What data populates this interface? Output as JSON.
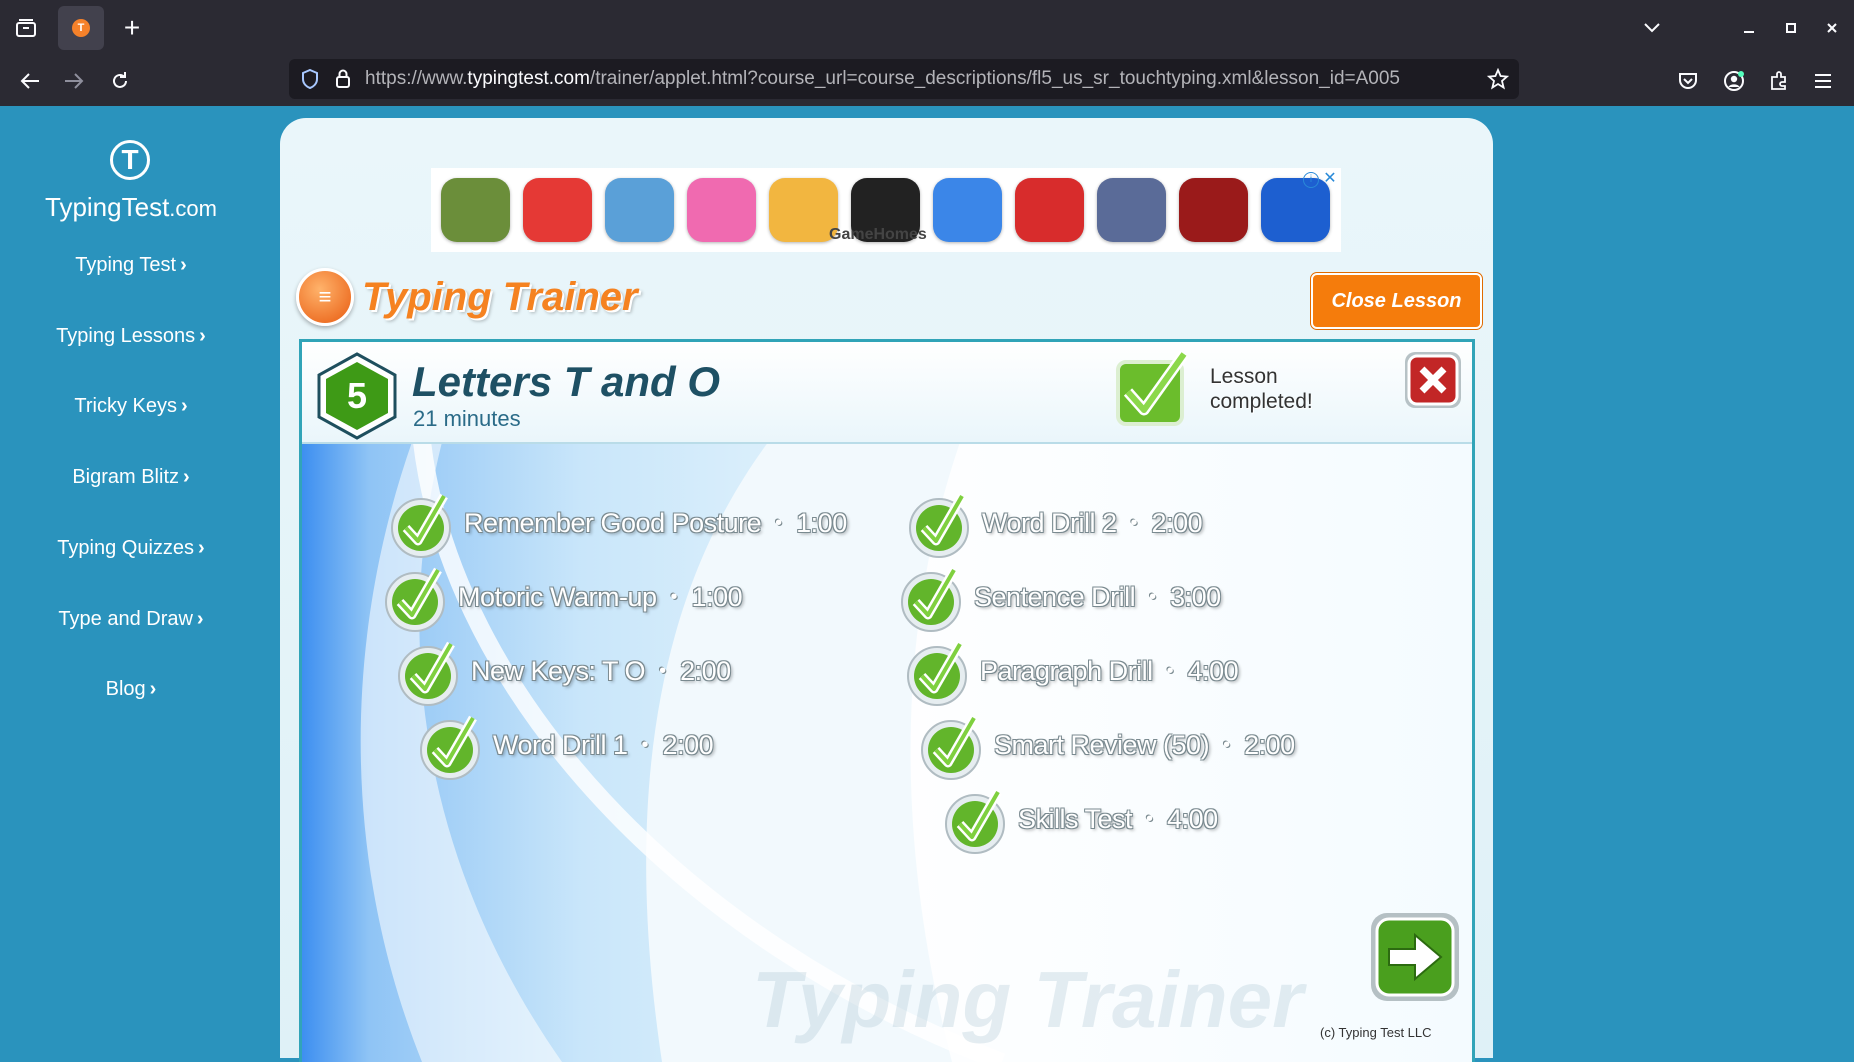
{
  "browser": {
    "url_prefix": "https://www.",
    "url_host": "typingtest.com",
    "url_path": "/trainer/applet.html?course_url=course_descriptions/fl5_us_sr_touchtyping.xml&lesson_id=A005",
    "new_tab_label": "+"
  },
  "sidebar": {
    "logo_name": "TypingTest",
    "logo_tld": ".com",
    "nav": [
      {
        "label": "Typing Test"
      },
      {
        "label": "Typing Lessons"
      },
      {
        "label": "Tricky Keys"
      },
      {
        "label": "Bigram Blitz"
      },
      {
        "label": "Typing Quizzes"
      },
      {
        "label": "Type and Draw"
      },
      {
        "label": "Blog"
      }
    ],
    "chevron": "›"
  },
  "ad": {
    "brand": "GameHomes",
    "tiles": [
      {
        "name": "minecraft",
        "color": "#6b8e3a"
      },
      {
        "name": "pokeball",
        "color": "#e53935"
      },
      {
        "name": "subway-surfers",
        "color": "#5aa0d8"
      },
      {
        "name": "talking-angela",
        "color": "#f06ab0"
      },
      {
        "name": "talking-tom-friends",
        "color": "#f2b640"
      },
      {
        "name": "roblox",
        "color": "#222222"
      },
      {
        "name": "snake",
        "color": "#3b86e8"
      },
      {
        "name": "among-us",
        "color": "#d82c2c"
      },
      {
        "name": "fortnite",
        "color": "#5a6b98"
      },
      {
        "name": "dragon",
        "color": "#9a1a1a"
      },
      {
        "name": "huggy-wuggy",
        "color": "#1d5fd0"
      }
    ]
  },
  "trainer": {
    "logo_text": "Typing Trainer",
    "close_lesson": "Close Lesson",
    "lesson_number": "5",
    "lesson_title": "Letters T and O",
    "lesson_duration": "21 minutes",
    "completed_line1": "Lesson",
    "completed_line2": "completed!",
    "watermark": "Typing Trainer",
    "copyright": "(c) Typing Test LLC",
    "accent": "#f57c0c",
    "check_color": "#5fb32a"
  },
  "exercises_left": [
    {
      "label": "Remember Good Posture",
      "time": "1:00"
    },
    {
      "label": "Motoric Warm-up",
      "time": "1:00"
    },
    {
      "label": "New Keys: T O",
      "time": "2:00"
    },
    {
      "label": "Word Drill 1",
      "time": "2:00"
    }
  ],
  "exercises_right": [
    {
      "label": "Word Drill 2",
      "time": "2:00"
    },
    {
      "label": "Sentence Drill",
      "time": "3:00"
    },
    {
      "label": "Paragraph Drill",
      "time": "4:00"
    },
    {
      "label": "Smart Review (50)",
      "time": "2:00"
    },
    {
      "label": "Skills Test",
      "time": "4:00"
    }
  ]
}
